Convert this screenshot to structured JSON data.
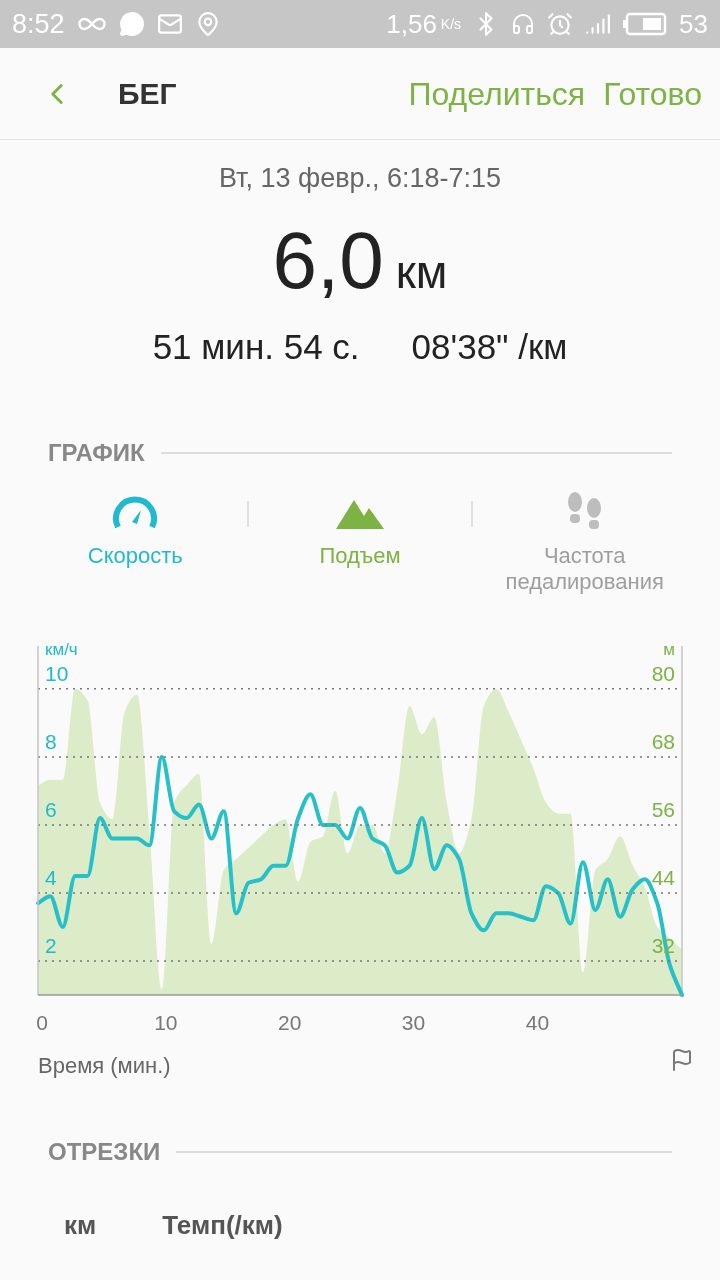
{
  "status_bar": {
    "time": "8:52",
    "speed": "1,56",
    "speed_unit": "K/s",
    "battery": "53"
  },
  "header": {
    "title": "БЕГ",
    "actions": [
      "Поделиться",
      "Готово"
    ]
  },
  "summary": {
    "date": "Вт, 13 февр., 6:18-7:15",
    "distance": "6,0",
    "distance_unit": "км",
    "duration": "51 мин. 54 с.",
    "pace": "08'38\" /км"
  },
  "graph": {
    "heading": "ГРАФИК",
    "tabs": [
      {
        "kind": "speedometer",
        "label": "Скорость",
        "selected": true,
        "color": "#1fb9d0"
      },
      {
        "kind": "mountain",
        "label": "Подъем",
        "selected": true,
        "color": "#7cb342"
      },
      {
        "kind": "footprints",
        "label": "Частота педалирования",
        "selected": false
      }
    ],
    "speed_chart": {
      "chart_data": {
        "type": "line",
        "xlabel": "Время (мин.)",
        "ylabel": "км/ч",
        "x": [
          0,
          1,
          2,
          3,
          4,
          5,
          6,
          7,
          8,
          9,
          10,
          11,
          12,
          13,
          14,
          15,
          16,
          17,
          18,
          19,
          20,
          21,
          22,
          23,
          24,
          25,
          26,
          27,
          28,
          29,
          30,
          31,
          32,
          33,
          34,
          35,
          36,
          37,
          38,
          39,
          40,
          41,
          42,
          43,
          44,
          45,
          46,
          47,
          48,
          49,
          50,
          51,
          52
        ],
        "xlim": [
          0,
          52
        ],
        "ylim": [
          1,
          11.26
        ],
        "xticks": [
          0,
          10,
          20,
          30,
          40
        ],
        "yticks": [
          2,
          4,
          6,
          8,
          10
        ],
        "grid": true,
        "series": [
          {
            "color": "#26c0c8",
            "values": [
              3.7,
              3.9,
              3.0,
              4.5,
              4.5,
              6.2,
              5.6,
              5.6,
              5.6,
              5.4,
              8.0,
              6.4,
              6.2,
              6.6,
              5.6,
              6.4,
              3.4,
              4.3,
              4.4,
              4.8,
              4.8,
              6.2,
              6.9,
              6.0,
              6.0,
              5.6,
              6.5,
              5.6,
              5.4,
              4.6,
              4.8,
              6.2,
              4.7,
              5.4,
              5.0,
              3.4,
              2.9,
              3.4,
              3.4,
              3.3,
              3.2,
              4.2,
              4.0,
              3.1,
              4.9,
              3.5,
              4.4,
              3.3,
              4.1,
              4.4,
              3.7,
              1.9,
              1.0
            ]
          }
        ]
      }
    },
    "elevation_chart": {
      "chart_data": {
        "type": "area",
        "ylabel": "м",
        "x": [
          0,
          1,
          2,
          3,
          4,
          5,
          6,
          7,
          8,
          9,
          10,
          11,
          12,
          13,
          14,
          15,
          16,
          17,
          18,
          19,
          20,
          21,
          22,
          23,
          24,
          25,
          26,
          27,
          28,
          29,
          30,
          31,
          32,
          33,
          34,
          35,
          36,
          37,
          38,
          39,
          40,
          41,
          42,
          43,
          44,
          45,
          46,
          47,
          48,
          49,
          50,
          51,
          52
        ],
        "xlim": [
          0,
          52
        ],
        "ylim": [
          26,
          87.59
        ],
        "yticks": [
          32,
          44,
          56,
          68,
          80
        ],
        "series": [
          {
            "color": "#dcebc8",
            "values": [
              63,
              64,
              64,
              80,
              78,
              60,
              57,
              76,
              79,
              55,
              27,
              60,
              63,
              65,
              35,
              48,
              50,
              52,
              54,
              56,
              57,
              46,
              53,
              54,
              62,
              51,
              56,
              56,
              51,
              62,
              77,
              72,
              75,
              60,
              51,
              57,
              77,
              80,
              76,
              71,
              66,
              60,
              58,
              58,
              30,
              48,
              50,
              54,
              49,
              45,
              38,
              36,
              34
            ]
          }
        ]
      }
    }
  },
  "segments": {
    "heading": "ОТРЕЗКИ",
    "columns": [
      "км",
      "Темп(/км)"
    ]
  }
}
